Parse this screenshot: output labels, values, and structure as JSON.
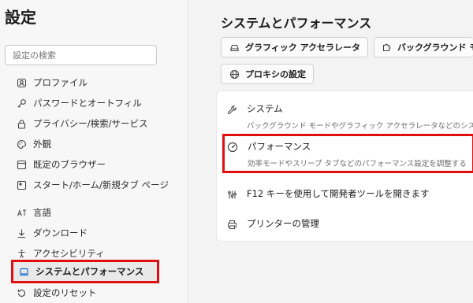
{
  "sidebar": {
    "title": "設定",
    "search_placeholder": "設定の検索",
    "items": [
      {
        "label": "プロファイル",
        "icon": "profile-icon"
      },
      {
        "label": "パスワードとオートフィル",
        "icon": "key-icon"
      },
      {
        "label": "プライバシー/検索/サービス",
        "icon": "lock-icon"
      },
      {
        "label": "外観",
        "icon": "palette-icon"
      },
      {
        "label": "既定のブラウザー",
        "icon": "browser-icon"
      },
      {
        "label": "スタート/ホーム/新規タブ ページ",
        "icon": "home-icon"
      },
      {
        "label": "言語",
        "icon": "language-icon"
      },
      {
        "label": "ダウンロード",
        "icon": "download-icon"
      },
      {
        "label": "アクセシビリティ",
        "icon": "accessibility-icon"
      },
      {
        "label": "システムとパフォーマンス",
        "icon": "laptop-icon",
        "active": true
      },
      {
        "label": "設定のリセット",
        "icon": "reset-icon"
      }
    ]
  },
  "main": {
    "title": "システムとパフォーマンス",
    "chips": [
      {
        "label": "グラフィック アクセラレータ",
        "icon": "drive-icon"
      },
      {
        "label": "バックグラウンド モ",
        "icon": "puzzle-icon"
      },
      {
        "label": "プロキシの設定",
        "icon": "globe-icon"
      }
    ],
    "rows": [
      {
        "title": "システム",
        "desc": "バックグラウンド モードやグラフィック アクセラレータなどのシス",
        "icon": "wrench-icon"
      },
      {
        "title": "パフォーマンス",
        "desc": "効率モードやスリープ タブなどのパフォーマンス設定を調整する",
        "icon": "gauge-icon"
      },
      {
        "title": "F12 キーを使用して開発者ツールを開きます",
        "desc": "",
        "icon": "devtools-icon"
      },
      {
        "title": "プリンターの管理",
        "desc": "",
        "icon": "printer-icon"
      }
    ]
  },
  "colors": {
    "highlight": "#e01010",
    "accent": "#1b6fd1"
  }
}
